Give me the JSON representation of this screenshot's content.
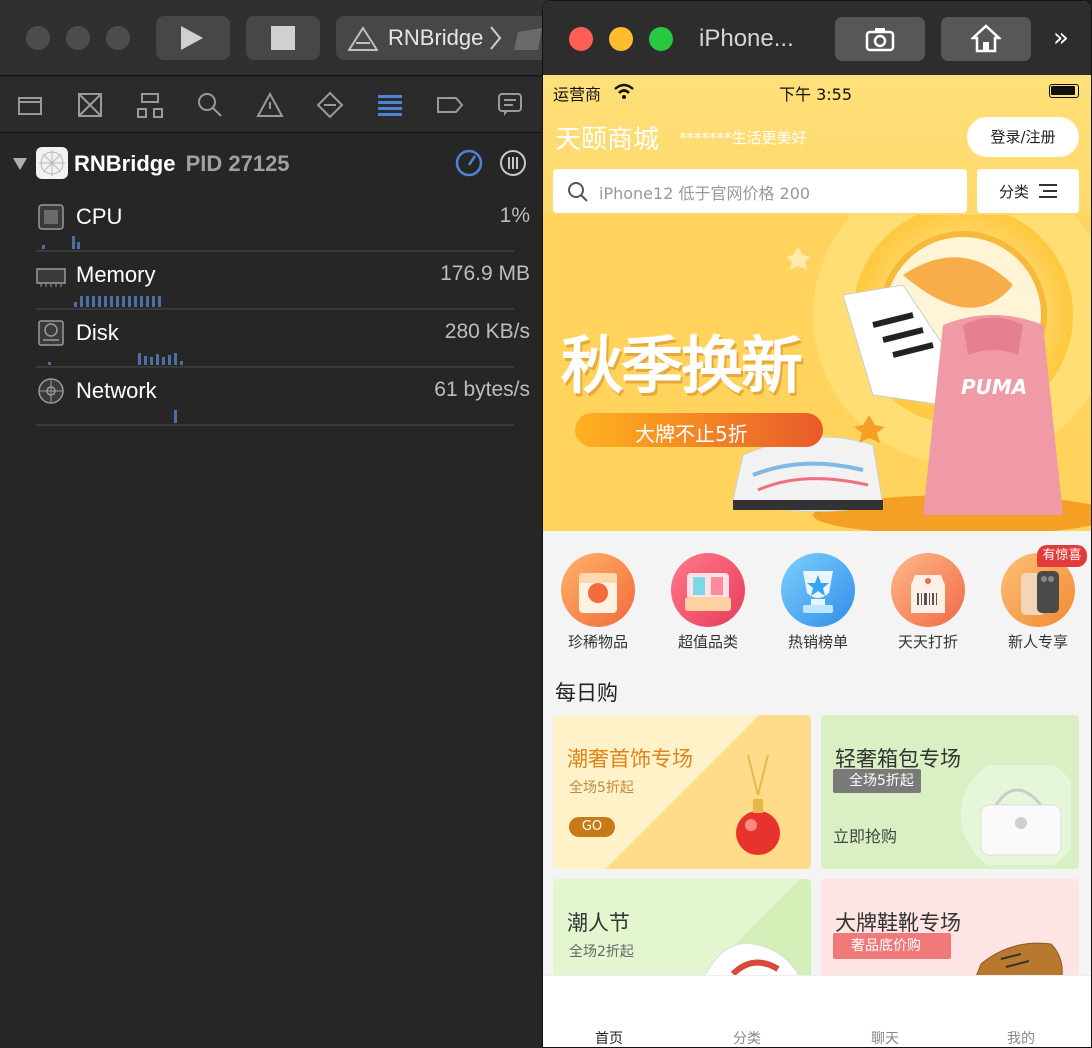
{
  "xcode": {
    "scheme": "RNBridge",
    "process_name": "RNBridge",
    "process_pid": "PID 27125",
    "gauges": [
      {
        "label": "CPU",
        "value": "1%"
      },
      {
        "label": "Memory",
        "value": "176.9 MB"
      },
      {
        "label": "Disk",
        "value": "280 KB/s"
      },
      {
        "label": "Network",
        "value": "61 bytes/s"
      }
    ]
  },
  "simulator": {
    "title": "iPhone...",
    "status": {
      "carrier": "运营商",
      "time": "下午 3:55"
    },
    "header": {
      "shop_title": "天颐商城",
      "slogan": "*******生活更美好",
      "login_label": "登录/注册",
      "search_placeholder": "iPhone12 低于官网价格 200",
      "category_label": "分类"
    },
    "banner": {
      "headline": "秋季换新",
      "pill_text": "大牌不止5折",
      "brand_text": "PUMA"
    },
    "categories": [
      {
        "label": "珍稀物品"
      },
      {
        "label": "超值品类"
      },
      {
        "label": "热销榜单"
      },
      {
        "label": "天天打折"
      },
      {
        "label": "新人专享"
      }
    ],
    "surprise_badge": "有惊喜",
    "daily_title": "每日购",
    "cards": [
      {
        "title": "潮奢首饰专场",
        "sub": "全场5折起",
        "cta": "GO"
      },
      {
        "title": "轻奢箱包专场",
        "sub": "全场5折起",
        "cta": "立即抢购"
      },
      {
        "title": "潮人节",
        "sub": "全场2折起"
      },
      {
        "title": "大牌鞋靴专场",
        "sub": "奢品底价购"
      }
    ],
    "tabs": [
      "首页",
      "分类",
      "聊天",
      "我的"
    ],
    "colors": {
      "header_yellow": "#ffd666",
      "accent_orange": "#e85a2a",
      "active_tab": "#222222"
    }
  }
}
